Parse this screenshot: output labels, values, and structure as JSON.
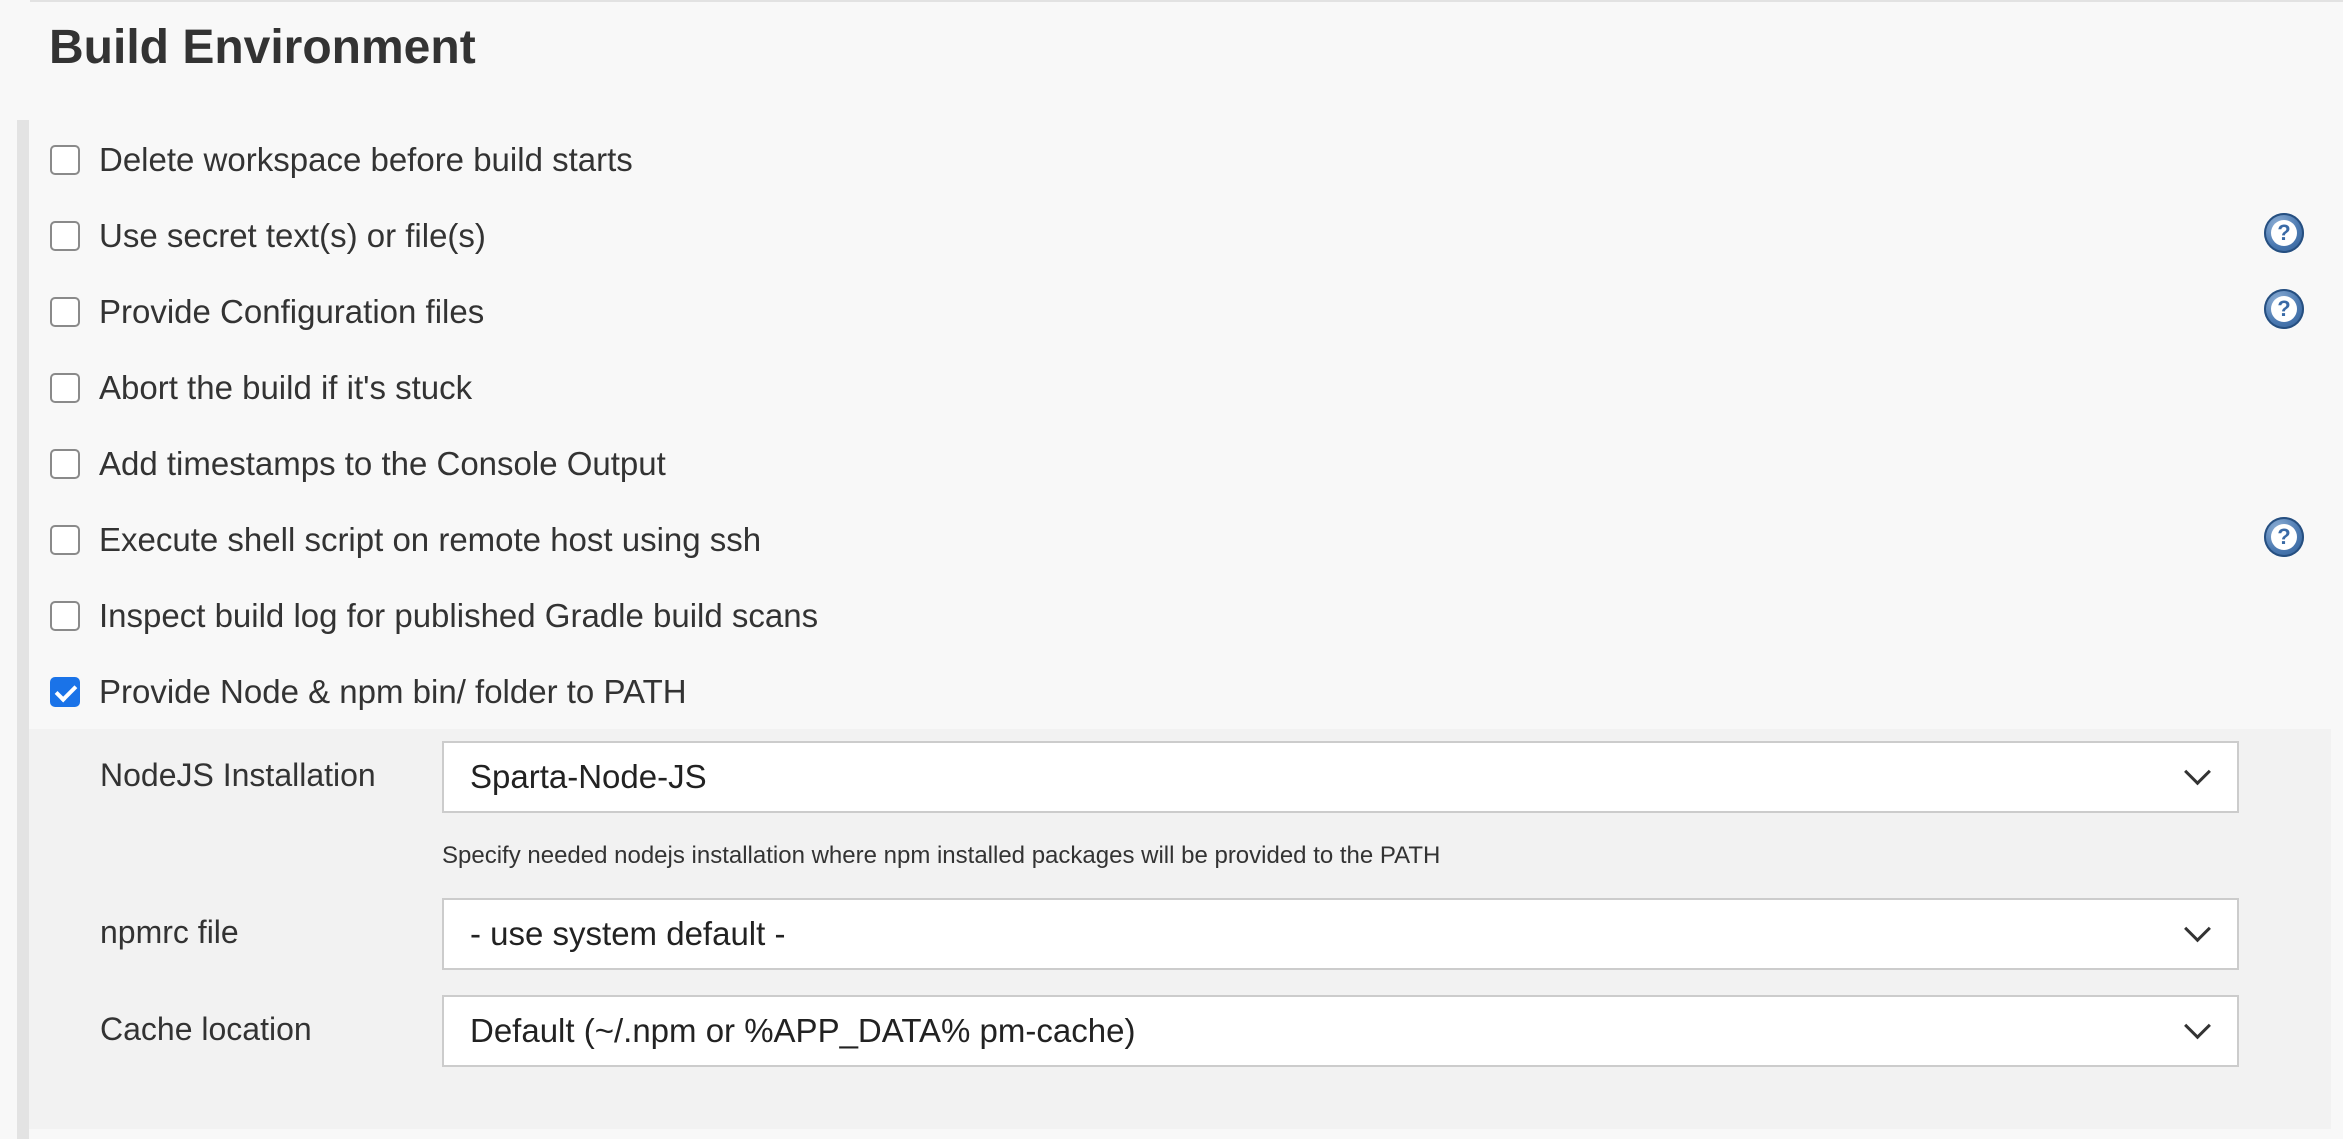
{
  "section": {
    "title": "Build Environment"
  },
  "options": [
    {
      "label": "Delete workspace before build starts",
      "checked": false,
      "has_help": false
    },
    {
      "label": "Use secret text(s) or file(s)",
      "checked": false,
      "has_help": true
    },
    {
      "label": "Provide Configuration files",
      "checked": false,
      "has_help": true
    },
    {
      "label": "Abort the build if it's stuck",
      "checked": false,
      "has_help": false
    },
    {
      "label": "Add timestamps to the Console Output",
      "checked": false,
      "has_help": false
    },
    {
      "label": "Execute shell script on remote host using ssh",
      "checked": false,
      "has_help": true
    },
    {
      "label": "Inspect build log for published Gradle build scans",
      "checked": false,
      "has_help": false
    },
    {
      "label": "Provide Node & npm bin/ folder to PATH",
      "checked": true,
      "has_help": false
    }
  ],
  "help": {
    "glyph": "?",
    "icon": "help-question-icon"
  },
  "node_config": {
    "nodejs_installation": {
      "label": "NodeJS Installation",
      "selected": "Sparta-Node-JS",
      "hint": "Specify needed nodejs installation where npm installed packages will be provided to the PATH"
    },
    "npmrc_file": {
      "label": "npmrc file",
      "selected": "- use system default -"
    },
    "cache_location": {
      "label": "Cache location",
      "selected": "Default (~/.npm or %APP_DATA% pm-cache)"
    }
  },
  "colors": {
    "background": "#f8f8f8",
    "nested_panel": "#f2f2f2",
    "checkbox_checked": "#1a73e8",
    "help_icon": "#4a78b0",
    "text": "#333333"
  }
}
